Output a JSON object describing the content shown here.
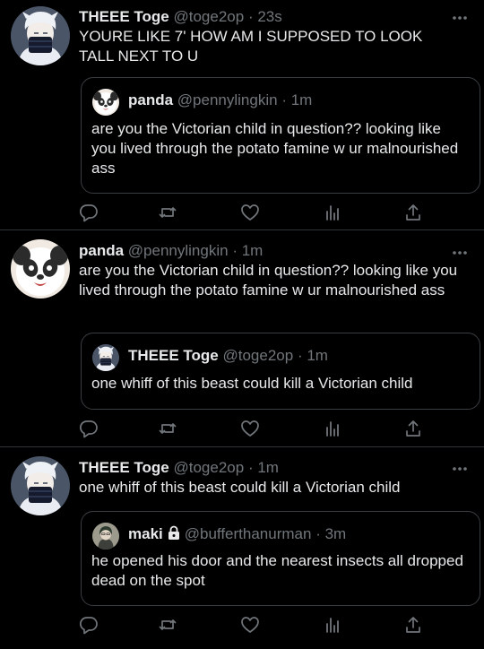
{
  "colors": {
    "background": "#000000",
    "text": "#e7e9ea",
    "secondary": "#71767b",
    "border": "#2f3336"
  },
  "tweets": [
    {
      "name": "THEEE Toge",
      "handle": "@toge2op",
      "separator": "·",
      "time": "23s",
      "text": "YOURE LIKE 7' HOW AM I SUPPOSED TO LOOK TALL NEXT TO U",
      "avatar": "toge-avatar",
      "quote": {
        "name": "panda",
        "handle": "@pennylingkin",
        "separator": "·",
        "time": "1m",
        "text": "are you the Victorian child in question?? looking like you lived through the potato famine w ur malnourished ass",
        "avatar": "panda-avatar"
      }
    },
    {
      "name": "panda",
      "handle": "@pennylingkin",
      "separator": "·",
      "time": "1m",
      "text": "are you the Victorian child in question?? looking like you lived through the potato famine w ur malnourished ass",
      "avatar": "panda-avatar",
      "quote": {
        "name": "THEEE Toge",
        "handle": "@toge2op",
        "separator": "·",
        "time": "1m",
        "text": "one whiff of this beast could kill a Victorian child",
        "avatar": "toge-avatar"
      }
    },
    {
      "name": "THEEE Toge",
      "handle": "@toge2op",
      "separator": "·",
      "time": "1m",
      "text": "one whiff of this beast could kill a Victorian child",
      "avatar": "toge-avatar",
      "quote": {
        "name": "maki",
        "handle": "@bufferthanurman",
        "separator": "·",
        "time": "3m",
        "text": "he opened his door and the nearest insects all dropped dead on the spot",
        "avatar": "maki-avatar",
        "protected": true
      }
    }
  ],
  "actions": [
    "reply-icon",
    "retweet-icon",
    "like-icon",
    "analytics-icon",
    "share-icon"
  ]
}
